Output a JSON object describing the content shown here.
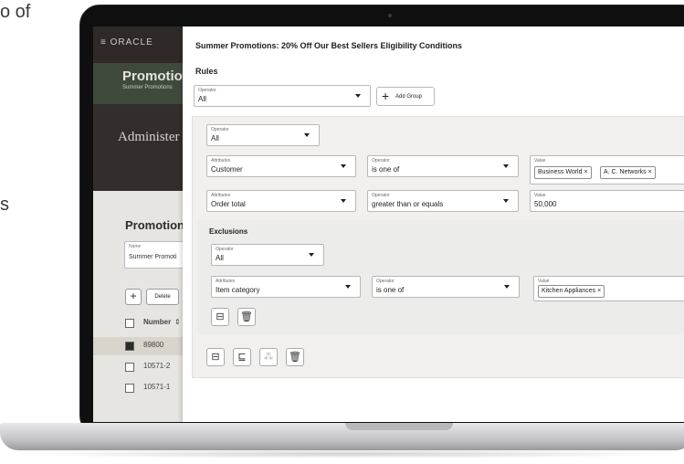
{
  "background": {
    "left_text_top": "o of",
    "left_text_mid": "s"
  },
  "app": {
    "brand": "ORACLE",
    "menu_icon": "hamburger-icon",
    "header_title": "Promotior",
    "header_sub": "Summer Promotions",
    "admin_text": "Administer",
    "promo_title": "Promotion i",
    "name_label": "Name",
    "name_value": "Summer Promoti",
    "delete_label": "Delete",
    "number_header": "Number",
    "rows": [
      {
        "number": "89800",
        "checked": true
      },
      {
        "number": "10571-2",
        "checked": false
      },
      {
        "number": "10571-1",
        "checked": false
      }
    ]
  },
  "panel": {
    "title": "Summer Promotions: 20% Off Our Best Sellers Eligibility Conditions",
    "rules_label": "Rules",
    "top_operator": {
      "label": "Operator",
      "value": "All"
    },
    "add_group_label": "Add Group",
    "group": {
      "operator": {
        "label": "Operator",
        "value": "All"
      },
      "cond1": {
        "attr_label": "Attributes",
        "attr_value": "Customer",
        "op_label": "Operator",
        "op_value": "is one of",
        "val_label": "Value",
        "chips": [
          "Business World ×",
          "A. C. Networks ×"
        ]
      },
      "cond2": {
        "attr_label": "Attributes",
        "attr_value": "Order total",
        "op_label": "Operator",
        "op_value": "greater than or equals",
        "val_label": "Value",
        "value": "50,000"
      },
      "exclusions": {
        "title": "Exclusions",
        "operator": {
          "label": "Operator",
          "value": "All"
        },
        "attr_label": "Attributes",
        "attr_value": "Item category",
        "op_label": "Operator",
        "op_value": "is one of",
        "val_label": "Value",
        "chips": [
          "Kitchen Appliances ×"
        ]
      }
    }
  }
}
